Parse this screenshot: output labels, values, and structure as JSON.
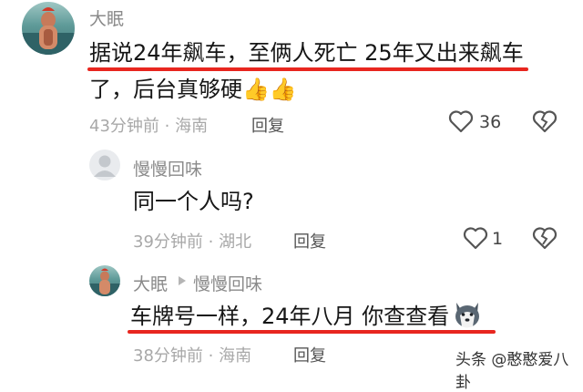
{
  "comments": [
    {
      "username": "大眠",
      "content_line1": "据说24年飙车，至俩人死亡  25年又出来飙车",
      "content_line2": "了，后台真够硬",
      "emoji": "👍👍",
      "time_location": "43分钟前 · 海南",
      "reply_label": "回复",
      "like_count": "36"
    }
  ],
  "replies": [
    {
      "username": "慢慢回味",
      "content": "同一个人吗?",
      "time_location": "39分钟前 · 湖北",
      "reply_label": "回复",
      "like_count": "1"
    },
    {
      "username": "大眠",
      "reply_to": "慢慢回味",
      "content": "车牌号一样，24年八月  你查查看",
      "time_location": "38分钟前 · 海南",
      "reply_label": "回复"
    }
  ],
  "watermark": "头条 @憨憨爱八卦",
  "colors": {
    "underline": "#e8261f",
    "meta_text": "#a8a8a8",
    "username": "#8a8a8a"
  }
}
